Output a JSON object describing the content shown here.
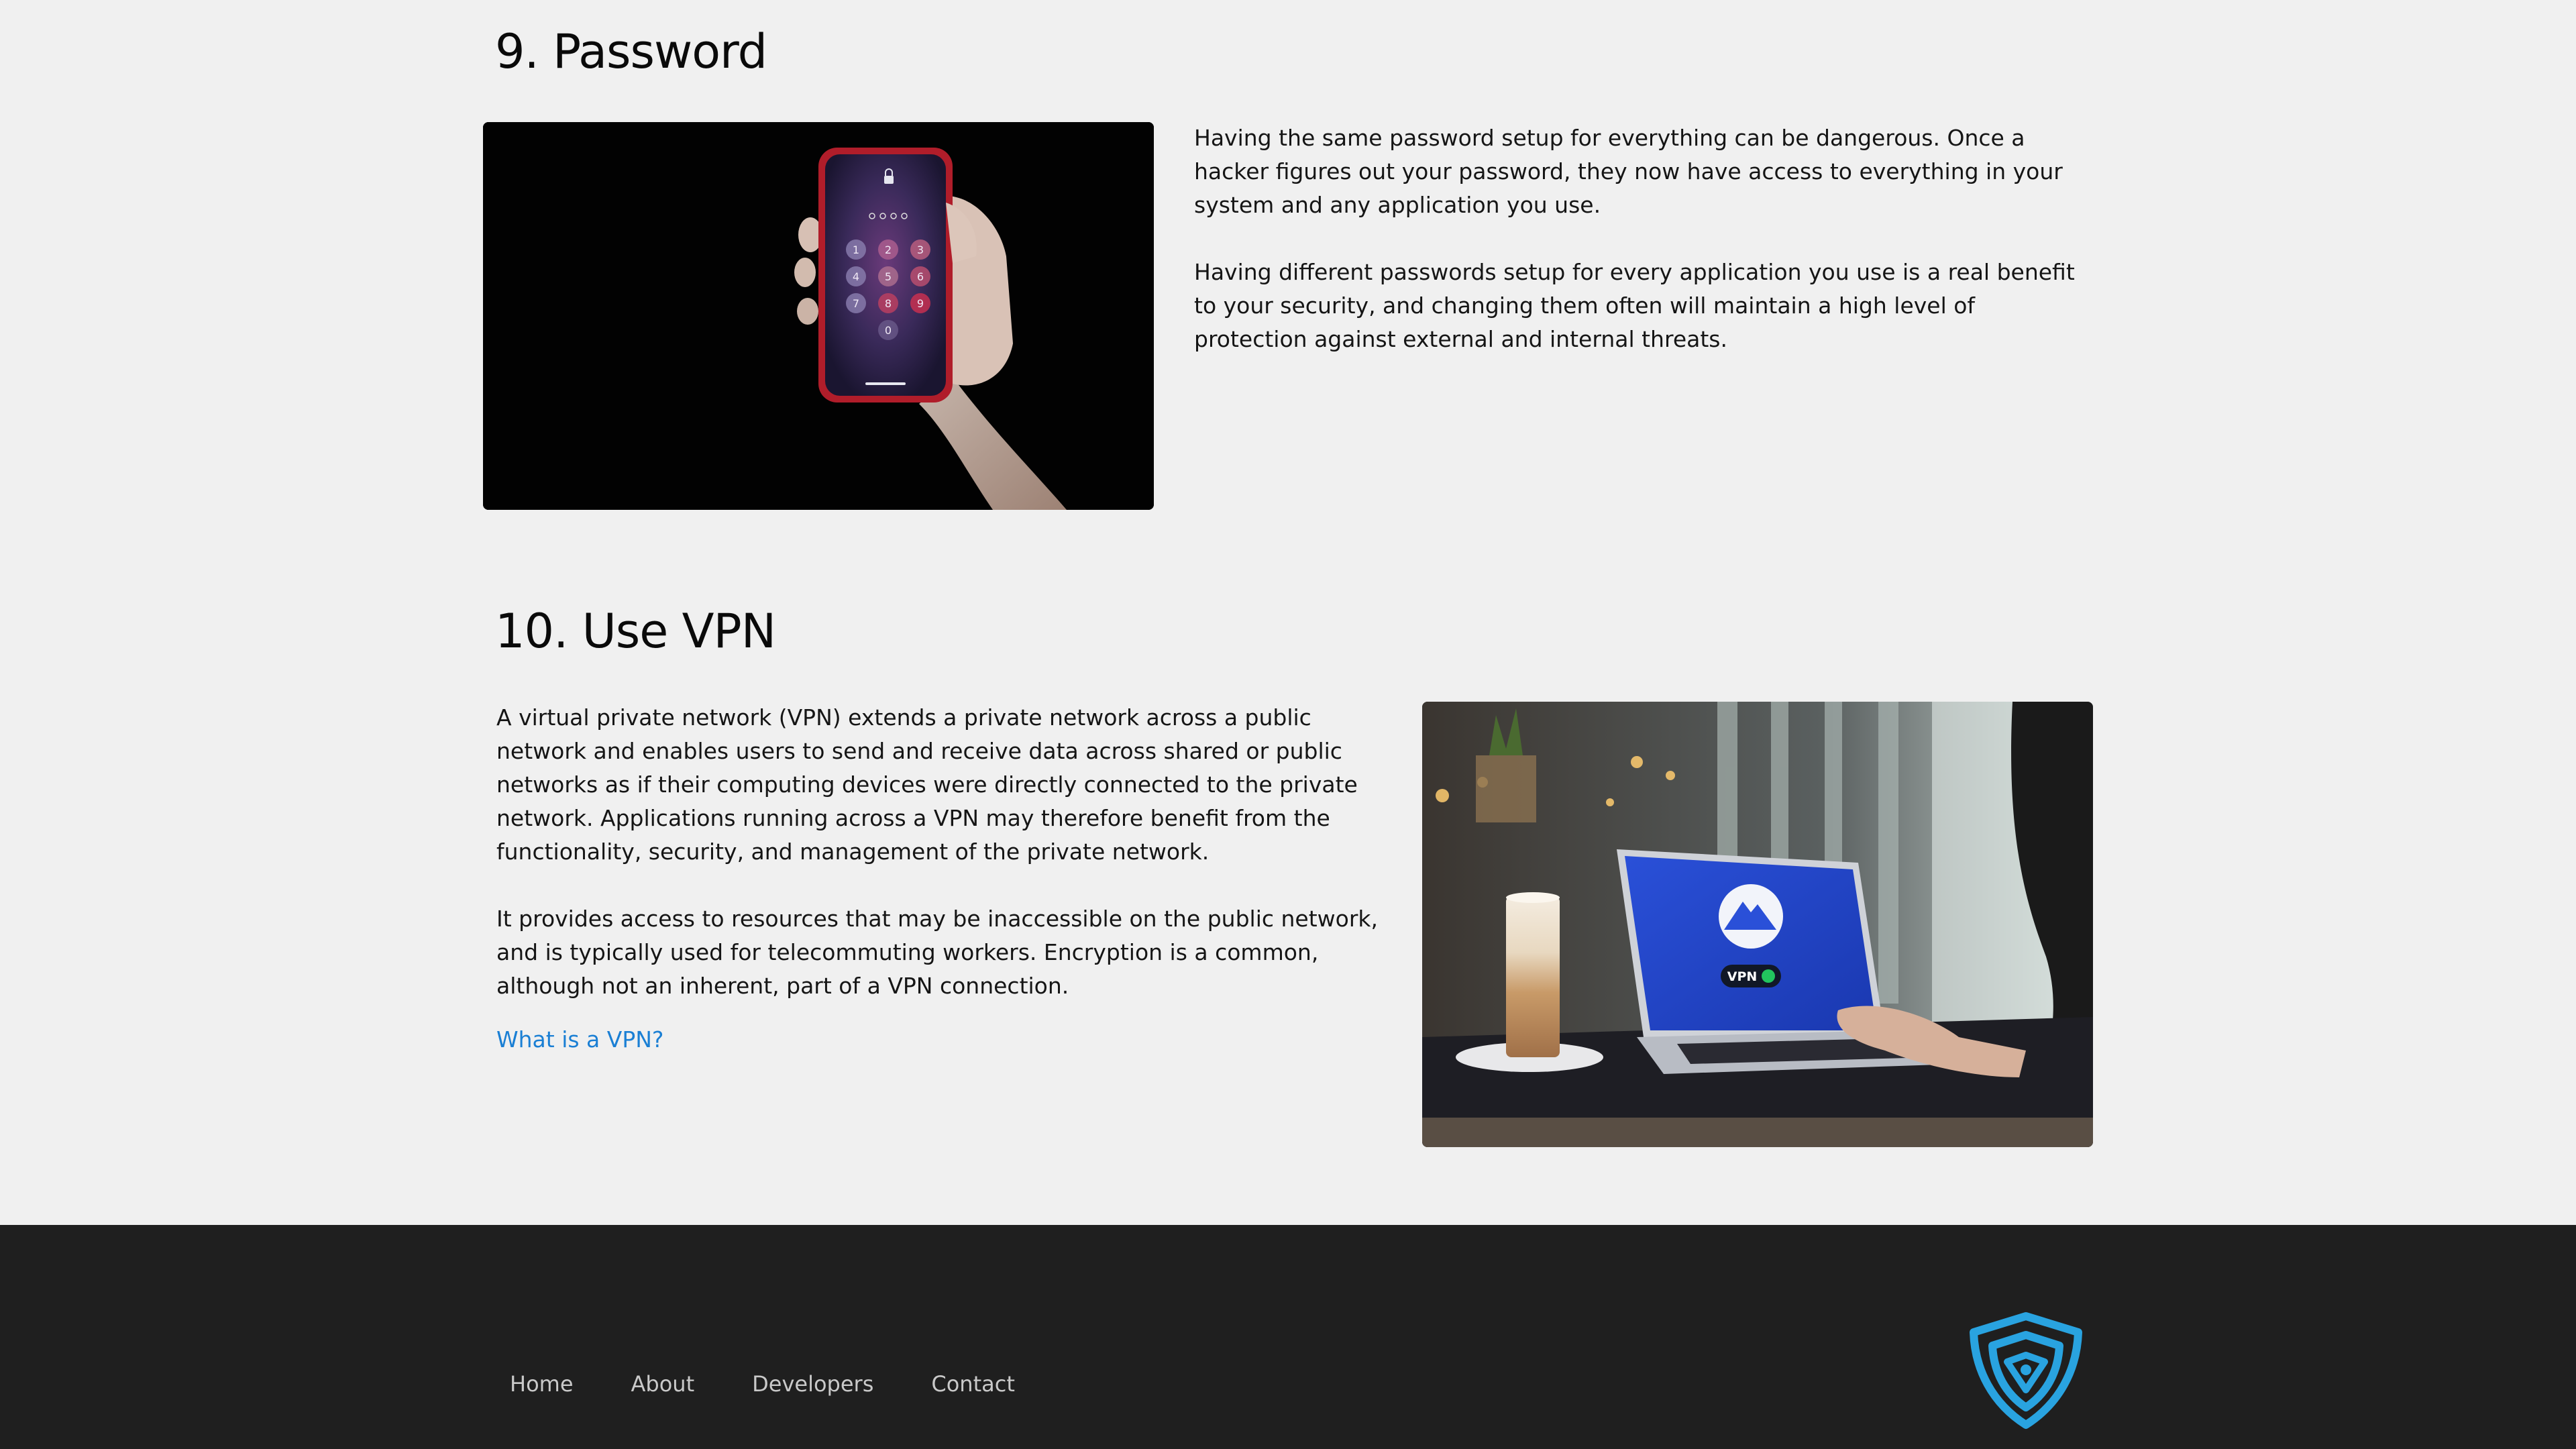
{
  "sections": {
    "password": {
      "title": "9. Password",
      "paragraphs": [
        "Having the same password setup for everything can be dangerous. Once a hacker figures out your password, they now have access to everything in your system and any application you use.",
        "Having different passwords setup for every application you use is a real benefit to your security, and changing them often will maintain a high level of protection against external and internal threats."
      ],
      "image_alt": "phone-lock-screen-photo",
      "keypad": [
        "1",
        "2",
        "3",
        "4",
        "5",
        "6",
        "7",
        "8",
        "9",
        "0"
      ]
    },
    "vpn": {
      "title": "10. Use VPN",
      "paragraphs": [
        "A virtual private network (VPN) extends a private network across a public network and enables users to send and receive data across shared or public networks as if their computing devices were directly connected to the private network. Applications running across a VPN may therefore benefit from the functionality, security, and management of the private network.",
        "It provides access to resources that may be inaccessible on the public network, and is typically used for telecommuting workers. Encryption is a common, although not an inherent, part of a VPN connection."
      ],
      "link_label": "What is a VPN?",
      "image_alt": "laptop-vpn-photo",
      "vpn_badge": "VPN"
    }
  },
  "footer": {
    "nav": [
      {
        "label": "Home",
        "name": "footer-link-home"
      },
      {
        "label": "About",
        "name": "footer-link-about"
      },
      {
        "label": "Developers",
        "name": "footer-link-developers"
      },
      {
        "label": "Contact",
        "name": "footer-link-contact"
      }
    ],
    "logo_icon": "shield-logo-icon"
  },
  "colors": {
    "page_bg": "#f0f0f0",
    "footer_bg": "#1f1f1f",
    "link": "#1a7fd4",
    "logo": "#29a3e0"
  }
}
